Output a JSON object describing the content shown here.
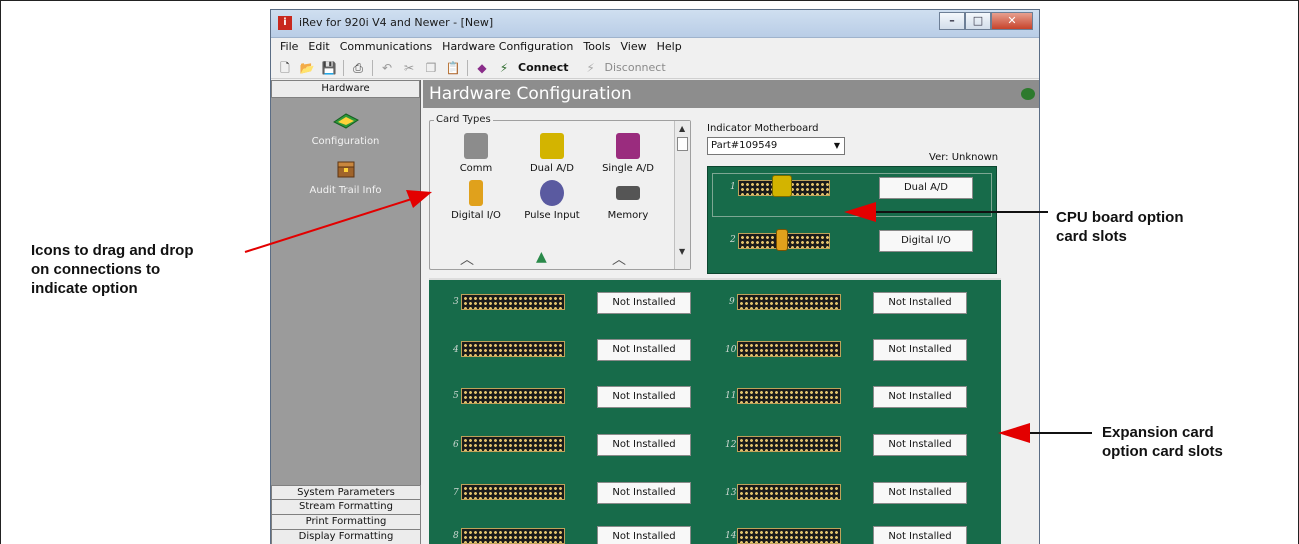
{
  "window": {
    "title": "iRev for 920i V4 and Newer - [New]",
    "app_icon": "i"
  },
  "menu": [
    "File",
    "Edit",
    "Communications",
    "Hardware Configuration",
    "Tools",
    "View",
    "Help"
  ],
  "toolbar": {
    "connect_label": "Connect",
    "disconnect_label": "Disconnect"
  },
  "sidebar": {
    "header": "Hardware",
    "items": [
      {
        "label": "Configuration",
        "icon": "circuit-board-icon"
      },
      {
        "label": "Audit Trail Info",
        "icon": "treasure-box-icon"
      }
    ],
    "bottom_buttons": [
      "System Parameters",
      "Stream Formatting",
      "Print Formatting",
      "Display Formatting"
    ]
  },
  "main": {
    "header": "Hardware Configuration",
    "card_types": {
      "legend": "Card Types",
      "items": [
        {
          "label": "Comm",
          "color": "#8c8c8c"
        },
        {
          "label": "Dual A/D",
          "color": "#d3b400"
        },
        {
          "label": "Single A/D",
          "color": "#9a2c7e"
        },
        {
          "label": "Digital I/O",
          "color": "#e0a11c"
        },
        {
          "label": "Pulse Input",
          "color": "#5a5aa0"
        },
        {
          "label": "Memory",
          "color": "#555555"
        }
      ]
    },
    "motherboard": {
      "label": "Indicator Motherboard",
      "part": "Part#109549",
      "version": "Ver: Unknown"
    },
    "cpu_slots": [
      {
        "num": "1",
        "label": "Dual A/D"
      },
      {
        "num": "2",
        "label": "Digital I/O"
      }
    ],
    "expansion_slots": [
      {
        "num": "3",
        "label": "Not Installed"
      },
      {
        "num": "9",
        "label": "Not Installed"
      },
      {
        "num": "4",
        "label": "Not Installed"
      },
      {
        "num": "10",
        "label": "Not Installed"
      },
      {
        "num": "5",
        "label": "Not Installed"
      },
      {
        "num": "11",
        "label": "Not Installed"
      },
      {
        "num": "6",
        "label": "Not Installed"
      },
      {
        "num": "12",
        "label": "Not Installed"
      },
      {
        "num": "7",
        "label": "Not Installed"
      },
      {
        "num": "13",
        "label": "Not Installed"
      },
      {
        "num": "8",
        "label": "Not Installed"
      },
      {
        "num": "14",
        "label": "Not Installed"
      }
    ]
  },
  "annotations": {
    "left": [
      "Icons to drag and drop",
      "on connections to",
      "indicate option"
    ],
    "cpu": [
      "CPU board option",
      "card slots"
    ],
    "expansion": [
      "Expansion card",
      "option card slots"
    ]
  },
  "colors": {
    "board_green": "#176b4a",
    "arrow_red": "#e30000",
    "header_gray": "#8d8d8d"
  }
}
